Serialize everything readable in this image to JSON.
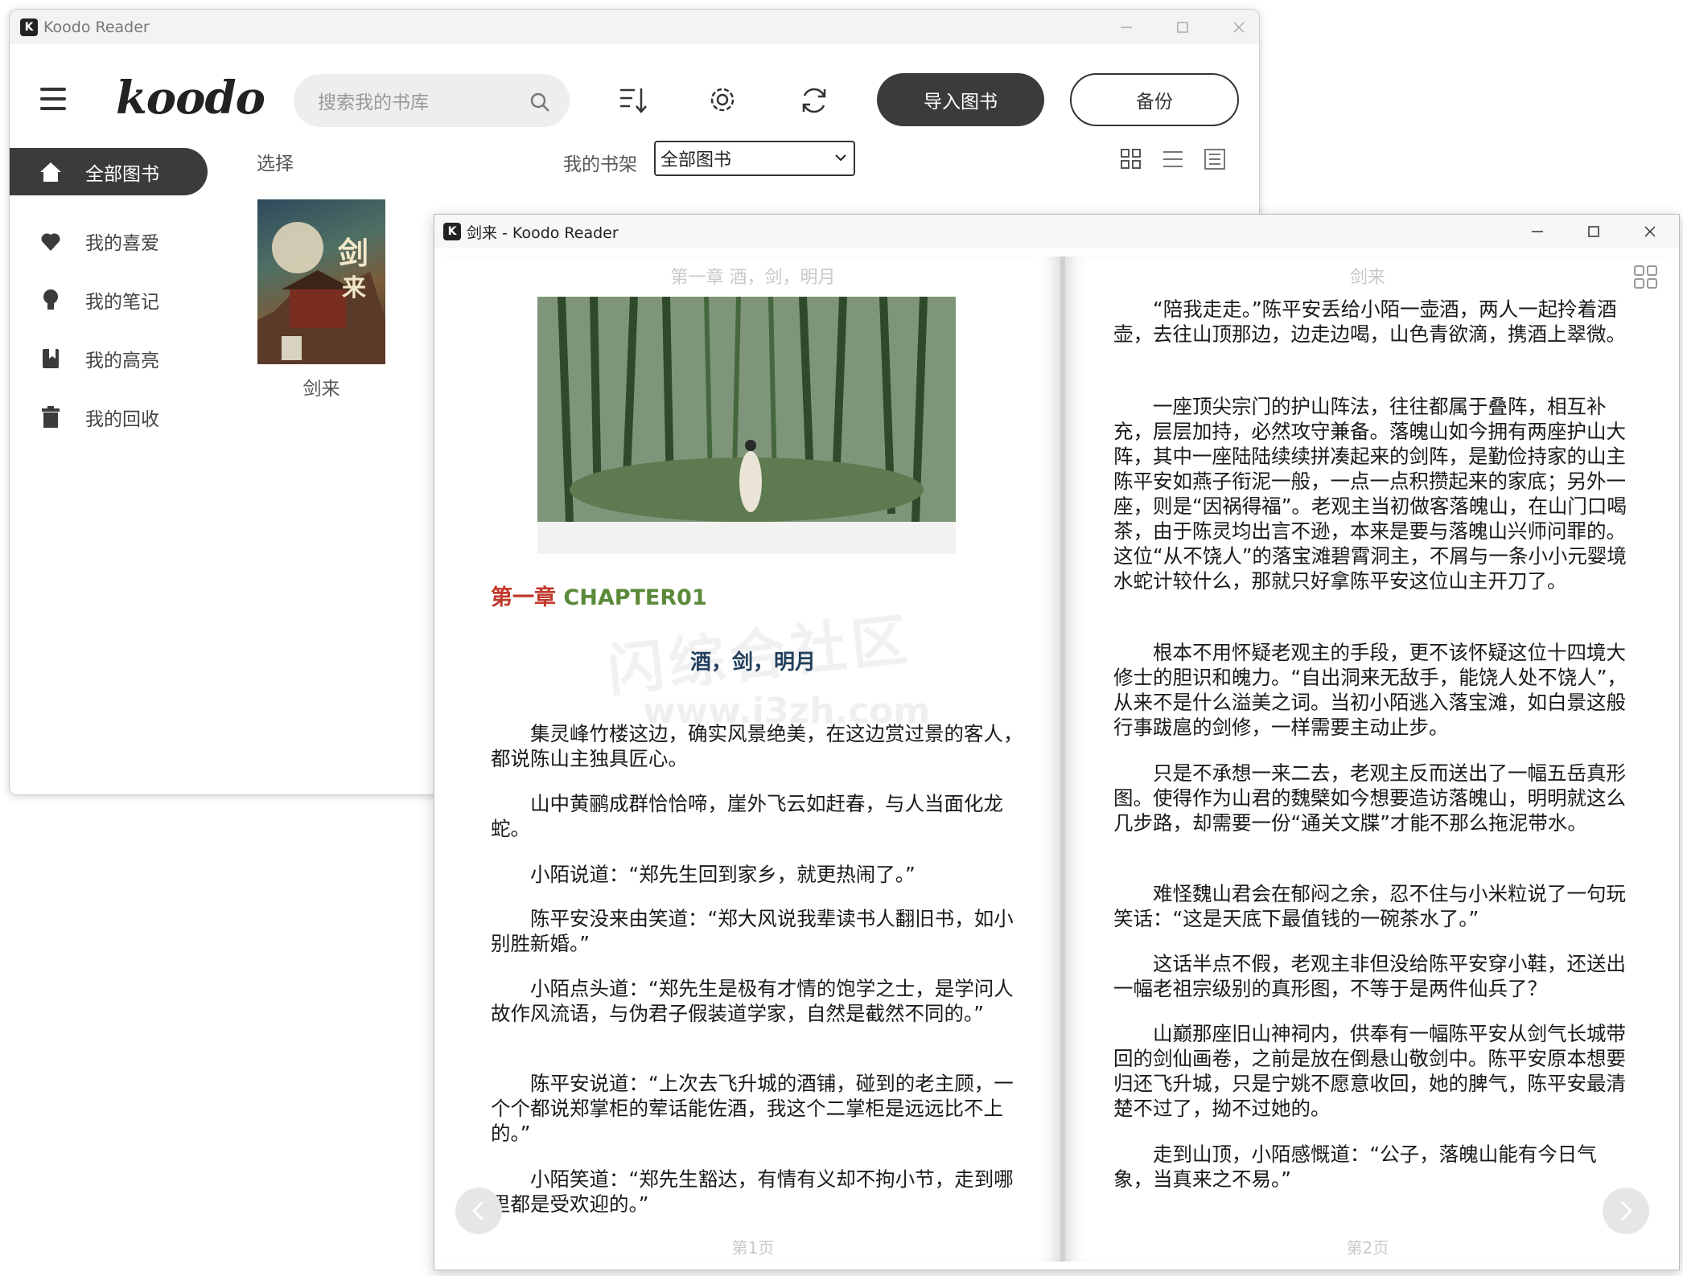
{
  "main_window": {
    "title": "Koodo Reader",
    "logo": "koodo",
    "search": {
      "placeholder": "搜索我的书库"
    },
    "toolbar": {
      "import_label": "导入图书",
      "backup_label": "备份"
    },
    "sidebar": {
      "items": [
        {
          "label": "全部图书",
          "icon": "home-icon",
          "active": true
        },
        {
          "label": "我的喜爱",
          "icon": "heart-icon"
        },
        {
          "label": "我的笔记",
          "icon": "lightbulb-icon"
        },
        {
          "label": "我的高亮",
          "icon": "bookmark-icon"
        },
        {
          "label": "我的回收",
          "icon": "trash-icon"
        }
      ]
    },
    "select_label": "选择",
    "shelf_label": "我的书架",
    "shelf_value": "全部图书",
    "books": [
      {
        "title": "剑来"
      }
    ]
  },
  "reader_window": {
    "title": "剑来 - Koodo Reader",
    "left_page": {
      "running_head": "第一章 酒，剑，明月",
      "chapter_zh": "第一章",
      "chapter_en": "CHAPTER01",
      "subtitle": "酒，剑，明月",
      "paragraphs": [
        "集灵峰竹楼这边，确实风景绝美，在这边赏过景的客人，都说陈山主独具匠心。",
        "山中黄鹂成群恰恰啼，崖外飞云如赶春，与人当面化龙蛇。",
        "小陌说道：“郑先生回到家乡，就更热闹了。”",
        "陈平安没来由笑道：“郑大风说我辈读书人翻旧书，如小别胜新婚。”",
        "小陌点头道：“郑先生是极有才情的饱学之士，是学问人故作风流语，与伪君子假装道学家，自然是截然不同的。”",
        "陈平安说道：“上次去飞升城的酒铺，碰到的老主顾，一个个都说郑掌柜的荤话能佐酒，我这个二掌柜是远远比不上的。”",
        "小陌笑道：“郑先生豁达，有情有义却不拘小节，走到哪里都是受欢迎的。”"
      ],
      "page_num": "第1页"
    },
    "right_page": {
      "running_head": "剑来",
      "paragraphs": [
        "“陪我走走。”陈平安丢给小陌一壶酒，两人一起拎着酒壶，去往山顶那边，边走边喝，山色青欲滴，携酒上翠微。",
        "一座顶尖宗门的护山阵法，往往都属于叠阵，相互补充，层层加持，必然攻守兼备。落魄山如今拥有两座护山大阵，其中一座陆陆续续拼凑起来的剑阵，是勤俭持家的山主陈平安如燕子衔泥一般，一点一点积攒起来的家底；另外一座，则是“因祸得福”。老观主当初做客落魄山，在山门口喝茶，由于陈灵均出言不逊，本来是要与落魄山兴师问罪的。这位“从不饶人”的落宝滩碧霄洞主，不屑与一条小小元婴境水蛇计较什么，那就只好拿陈平安这位山主开刀了。",
        "根本不用怀疑老观主的手段，更不该怀疑这位十四境大修士的胆识和魄力。“自出洞来无敌手，能饶人处不饶人”，从来不是什么溢美之词。当初小陌逃入落宝滩，如白景这般行事跋扈的剑修，一样需要主动止步。",
        "只是不承想一来二去，老观主反而送出了一幅五岳真形图。使得作为山君的魏檗如今想要造访落魄山，明明就这么几步路，却需要一份“通关文牒”才能不那么拖泥带水。",
        "难怪魏山君会在郁闷之余，忍不住与小米粒说了一句玩笑话：“这是天底下最值钱的一碗茶水了。”",
        "这话半点不假，老观主非但没给陈平安穿小鞋，还送出一幅老祖宗级别的真形图，不等于是两件仙兵了？",
        "山巅那座旧山神祠内，供奉有一幅陈平安从剑气长城带回的剑仙画卷，之前是放在倒悬山敬剑中。陈平安原本想要归还飞升城，只是宁姚不愿意收回，她的脾气，陈平安最清楚不过了，拗不过她的。",
        "走到山顶，小陌感慨道：“公子，落魄山能有今日气象，当真来之不易。”"
      ],
      "page_num": "第2页"
    },
    "watermark": "闪综合社区",
    "watermark_url": "www.i3zh.com"
  }
}
